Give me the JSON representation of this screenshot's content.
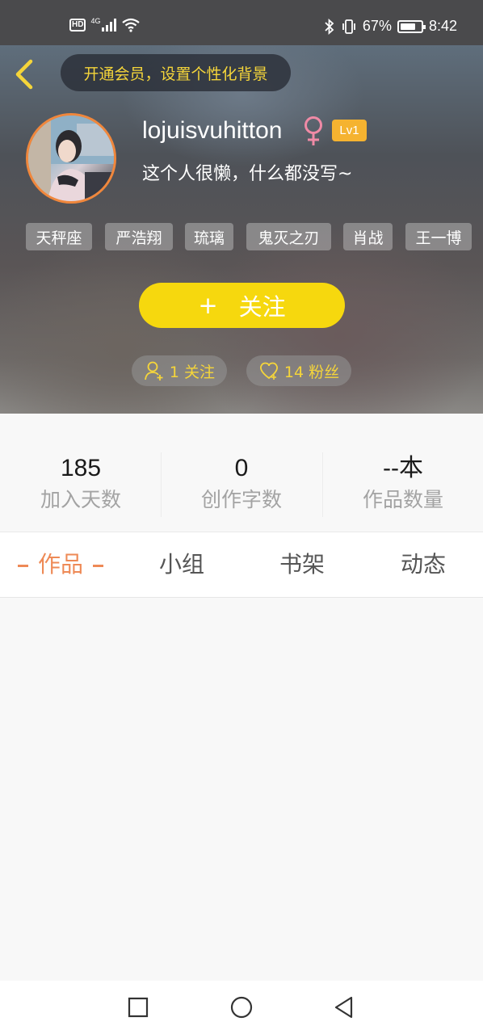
{
  "status_bar": {
    "hd": "HD",
    "network": "4G",
    "battery_percent": "67%",
    "time": "8:42",
    "icons": [
      "signal-icon",
      "wifi-icon",
      "bluetooth-icon",
      "vibrate-icon",
      "battery-icon"
    ]
  },
  "header": {
    "vip_prompt": "开通会员，设置个性化背景",
    "back_icon": "chevron-left-icon"
  },
  "profile": {
    "username": "lojuisvuhitton",
    "gender_symbol": "♀",
    "level": "Lv1",
    "bio": "这个人很懒，什么都没写~",
    "tags": [
      "天秤座",
      "严浩翔",
      "琉璃",
      "鬼灭之刃",
      "肖战",
      "王一博"
    ],
    "follow_button": "关注",
    "follow_plus": "+",
    "following": "1 关注",
    "fans": "14 粉丝"
  },
  "stats": [
    {
      "value": "185",
      "label": "加入天数"
    },
    {
      "value": "0",
      "label": "创作字数"
    },
    {
      "value": "--本",
      "label": "作品数量"
    }
  ],
  "tabs": [
    {
      "label": "作品",
      "active": true
    },
    {
      "label": "小组",
      "active": false
    },
    {
      "label": "书架",
      "active": false
    },
    {
      "label": "动态",
      "active": false
    }
  ],
  "nav_bar": [
    "recents-square-icon",
    "home-circle-icon",
    "back-triangle-icon"
  ],
  "colors": {
    "accent_yellow": "#f6d80e",
    "vip_text": "#f5d53a",
    "active_tab": "#ee8a56",
    "level_badge": "#f5b330",
    "gender_pink": "#f08aa6",
    "avatar_ring": "#f0873c"
  }
}
